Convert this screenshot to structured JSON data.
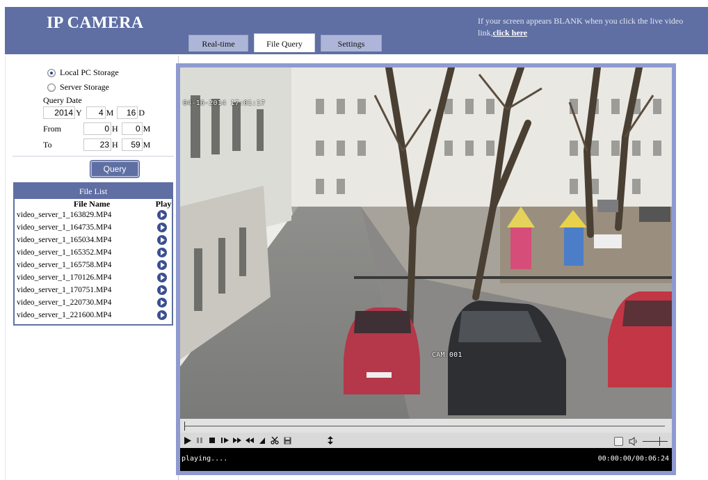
{
  "header": {
    "brand": "IP CAMERA",
    "notice_text": "If your screen appears BLANK when you click the live video link,",
    "notice_link": "click here",
    "tabs": [
      {
        "label": "Real-time"
      },
      {
        "label": "File Query"
      },
      {
        "label": "Settings"
      }
    ],
    "active_tab": "File Query"
  },
  "storage": {
    "local_label": "Local PC Storage",
    "server_label": "Server Storage",
    "selected": "Local PC Storage"
  },
  "query": {
    "date_label": "Query Date",
    "year": "2014",
    "year_unit": "Y",
    "month": "4",
    "month_unit": "M",
    "day": "16",
    "day_unit": "D",
    "from_label": "From",
    "from_hour": "0",
    "from_min": "0",
    "to_label": "To",
    "to_hour": "23",
    "to_min": "59",
    "hour_unit": "H",
    "min_unit": "M",
    "button": "Query"
  },
  "file_list": {
    "title": "File List",
    "col_name": "File Name",
    "col_play": "Play",
    "files": [
      "video_server_1_163829.MP4",
      "video_server_1_164735.MP4",
      "video_server_1_165034.MP4",
      "video_server_1_165352.MP4",
      "video_server_1_165758.MP4",
      "video_server_1_170126.MP4",
      "video_server_1_170751.MP4",
      "video_server_1_220730.MP4",
      "video_server_1_221600.MP4"
    ]
  },
  "player": {
    "osd_timestamp": "04-16-2014 17:01:17",
    "osd_camera": "CAM 001",
    "status": "playing....",
    "time": "00:00:00/00:06:24",
    "seek_fraction": 0.0
  },
  "colors": {
    "header": "#5f6fa3",
    "tab_inactive": "#adb6d8",
    "player_border": "#8e9ad0"
  }
}
